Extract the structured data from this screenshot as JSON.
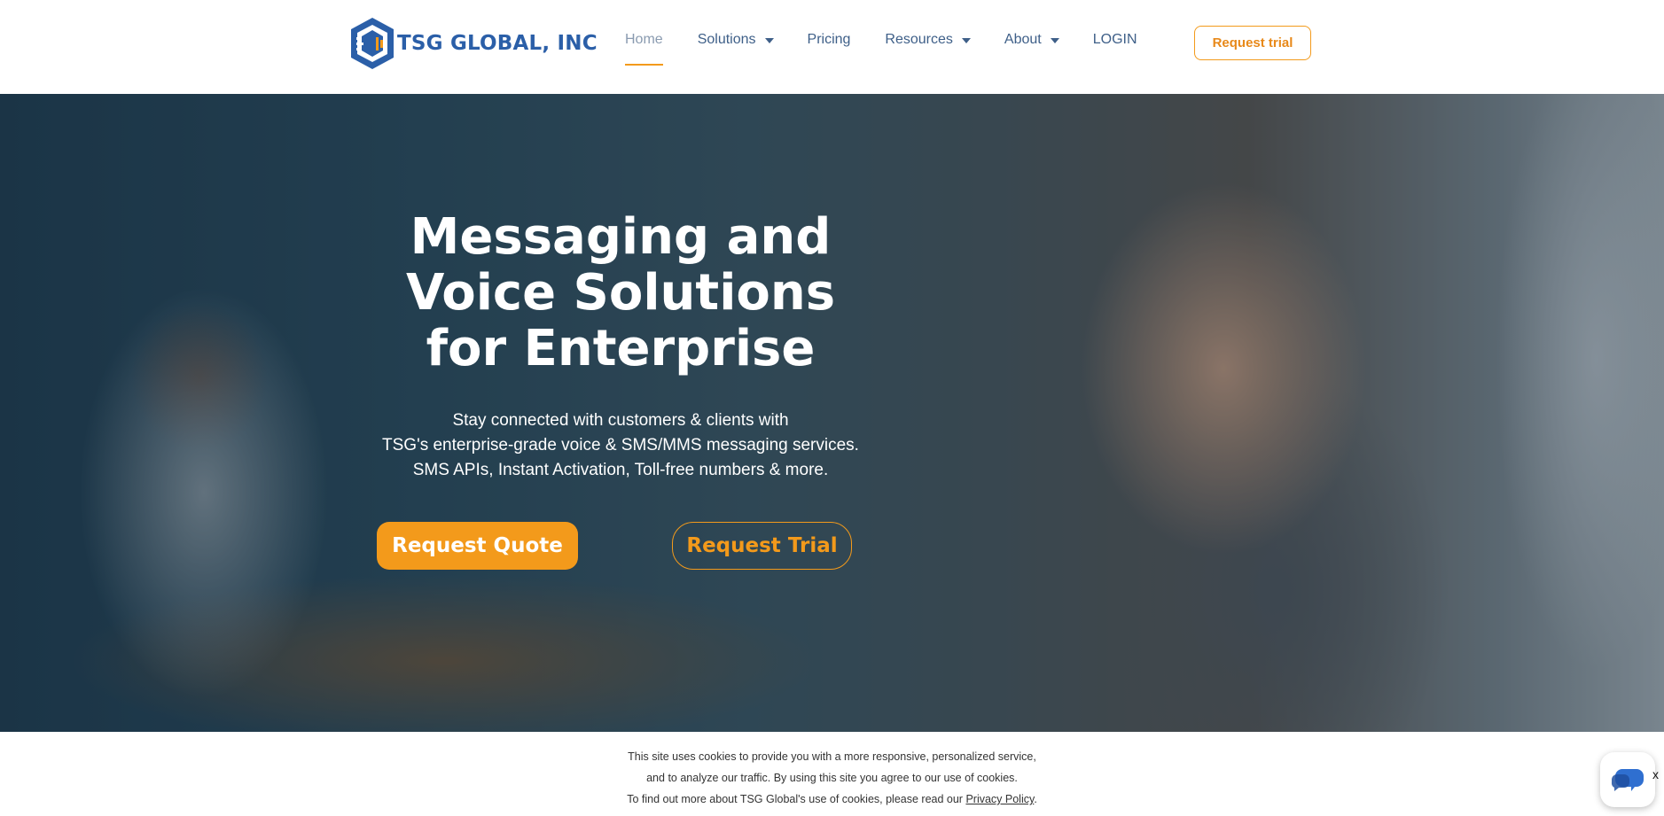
{
  "brand": {
    "name": "TSG GLOBAL, INC",
    "logo_icon": "hexagon-shield-icon"
  },
  "nav": {
    "items": [
      {
        "label": "Home",
        "active": true,
        "dropdown": false
      },
      {
        "label": "Solutions",
        "active": false,
        "dropdown": true
      },
      {
        "label": "Pricing",
        "active": false,
        "dropdown": false
      },
      {
        "label": "Resources",
        "active": false,
        "dropdown": true
      },
      {
        "label": "About",
        "active": false,
        "dropdown": true
      },
      {
        "label": "LOGIN",
        "active": false,
        "dropdown": false
      }
    ],
    "cta_label": "Request trial"
  },
  "hero": {
    "title_line1": "Messaging and",
    "title_line2": "Voice Solutions",
    "title_line3": "for Enterprise",
    "sub_line1": "Stay connected with customers & clients with",
    "sub_line2": "TSG's enterprise-grade voice & SMS/MMS messaging services.",
    "sub_line3": "SMS APIs, Instant Activation, Toll-free numbers & more.",
    "quote_label": "Request Quote",
    "trial_label": "Request Trial"
  },
  "cookie": {
    "line1": "This site uses cookies to provide you with a more responsive, personalized service,",
    "line2": "and to analyze our traffic. By using this site you agree to our use of cookies.",
    "line3_prefix": "To find out more about TSG Global's use of cookies, please read our ",
    "link_label": "Privacy Policy",
    "line3_suffix": ".",
    "close_label": "x"
  },
  "colors": {
    "accent": "#f39a1b",
    "brand_blue": "#2b5fa8",
    "nav_text": "#3e5f88",
    "chat_blue": "#2f6fd0"
  },
  "chat": {
    "icon": "chat-bubbles-icon"
  }
}
